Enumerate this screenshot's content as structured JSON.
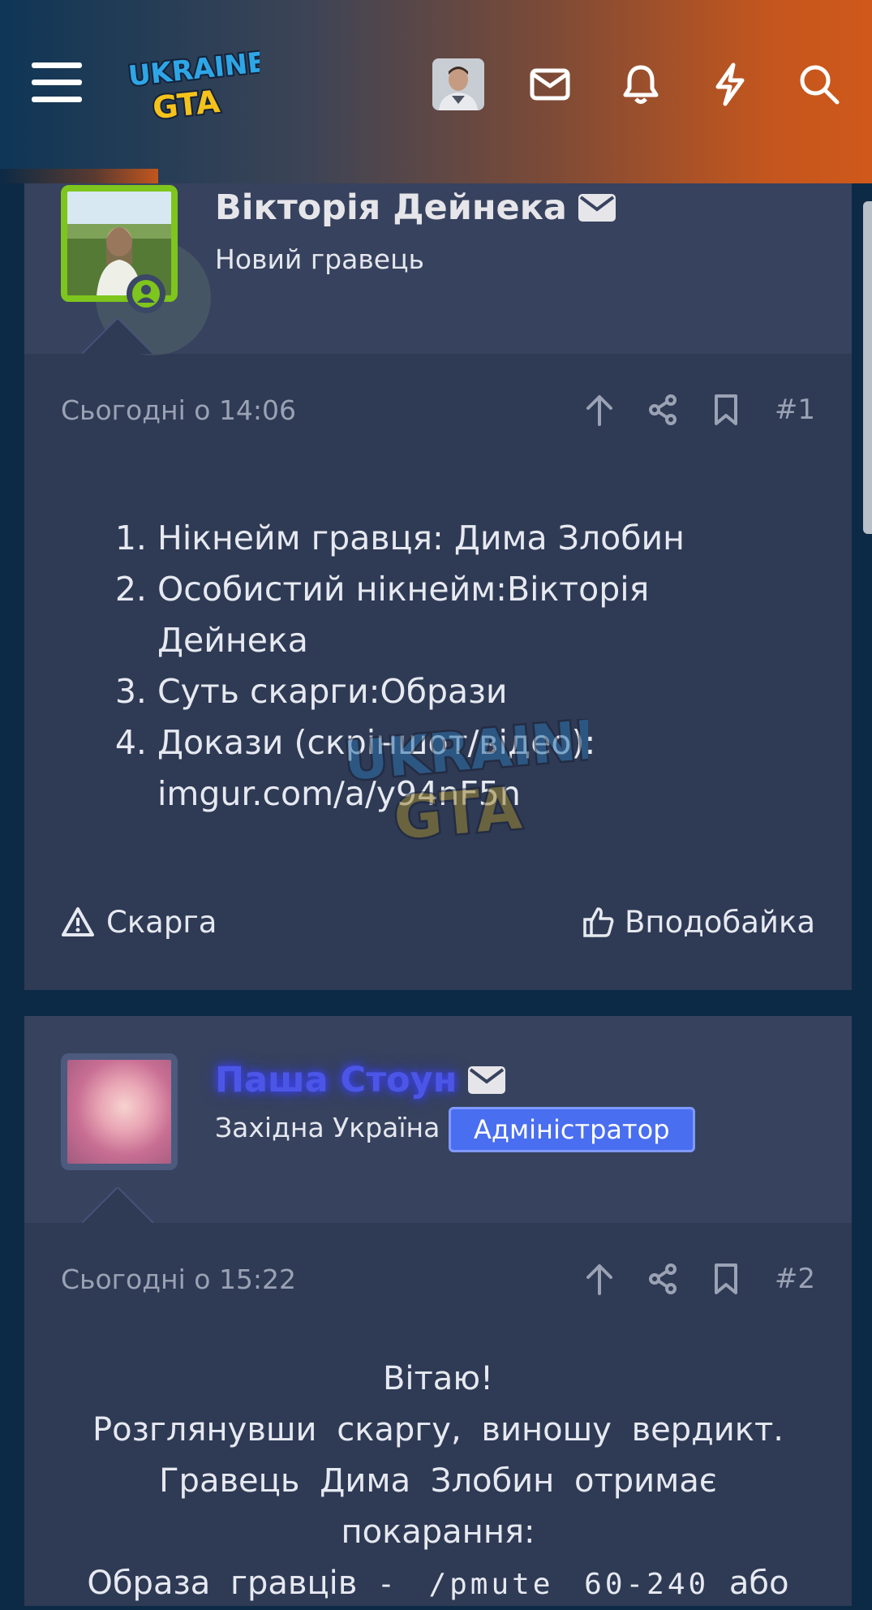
{
  "header": {
    "logo_text_top": "UKRAINE",
    "logo_text_bottom": "GTA"
  },
  "posts": [
    {
      "username": "Вікторія Дейнека",
      "user_title": "Новий гравець",
      "time": "Сьогодні о 14:06",
      "number": "#1",
      "items": [
        "Нікнейм гравця: Дима Злобин",
        "Особистий нікнейм:Вікторія Дейнека",
        "Суть скарги:Образи",
        "Докази (скріншот/відео): imgur.com/a/y94nF5n"
      ],
      "report_label": "Скарга",
      "like_label": "Вподобайка"
    },
    {
      "username": "Паша Стоун",
      "user_title": "Західна Україна",
      "role": "Адміністратор",
      "time": "Сьогодні о 15:22",
      "number": "#2",
      "lines": [
        "Вітаю!",
        "Розглянувши скаргу, виношу вердикт.",
        "Гравець Дима Злобин отримає",
        "покарання:"
      ],
      "last_line_a": "Образа гравців",
      "last_line_code": "- /pmute 60-240",
      "last_line_b": "або"
    }
  ],
  "colors": {
    "accent_green": "#7ec51d",
    "admin_badge": "#4a6ef0",
    "admin_name": "#4c56e6",
    "header_orange": "#d0581a"
  }
}
